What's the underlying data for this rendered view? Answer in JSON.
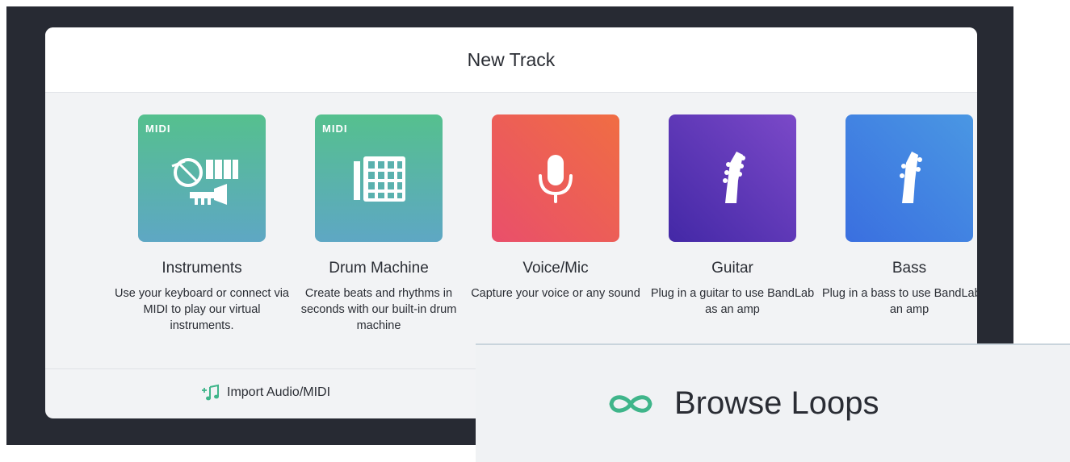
{
  "dialog": {
    "title": "New Track"
  },
  "cards": [
    {
      "title": "Instruments",
      "badge": "MIDI",
      "icon": "instruments-icon",
      "description": "Use your keyboard or connect via MIDI to play our virtual instruments.",
      "colors": [
        "#55c08e",
        "#5ea7c4"
      ]
    },
    {
      "title": "Drum Machine",
      "badge": "MIDI",
      "icon": "drum-pad-icon",
      "description": "Create beats and rhythms in seconds with our built-in drum machine",
      "colors": [
        "#55c08e",
        "#5ea7c4"
      ]
    },
    {
      "title": "Voice/Mic",
      "icon": "microphone-icon",
      "description": "Capture your voice or any sound",
      "colors": [
        "#f06d43",
        "#e94f6b"
      ]
    },
    {
      "title": "Guitar",
      "icon": "guitar-headstock-icon",
      "description": "Plug in a guitar to use BandLab as an amp",
      "colors": [
        "#7b49c8",
        "#4328a6"
      ]
    },
    {
      "title": "Bass",
      "icon": "bass-headstock-icon",
      "description": "Plug in a bass to use BandLab as an amp",
      "colors": [
        "#4a97e3",
        "#3a6fe0"
      ]
    }
  ],
  "footer": {
    "import_label": "Import Audio/MIDI",
    "import_icon": "add-music-note-icon"
  },
  "browse": {
    "label": "Browse Loops",
    "icon": "infinity-icon",
    "accent": "#3fb58a"
  }
}
